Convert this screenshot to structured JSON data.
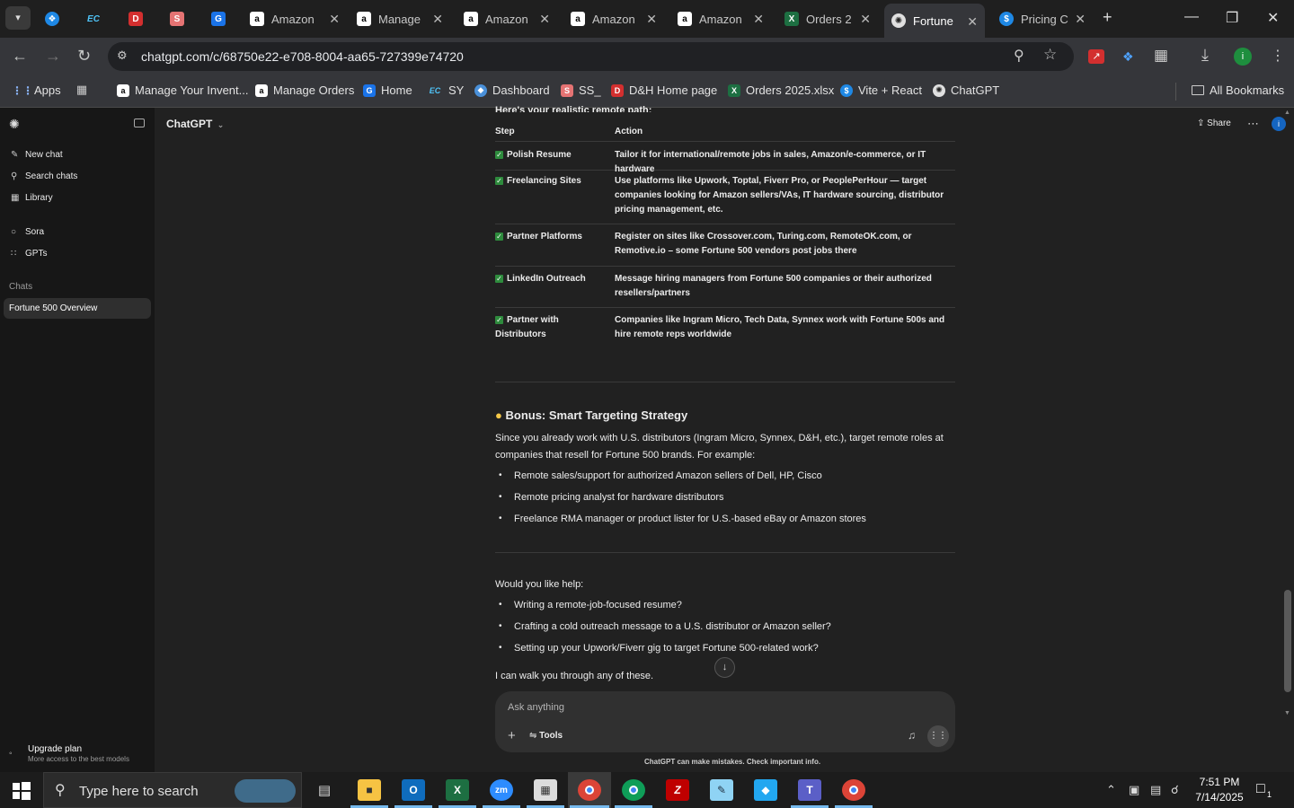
{
  "browser": {
    "tabs": [
      {
        "title": "",
        "icon": "dh-icon"
      },
      {
        "title": "",
        "icon": "ec-icon"
      },
      {
        "title": "",
        "icon": "dh-red-icon"
      },
      {
        "title": "",
        "icon": "ss-icon"
      },
      {
        "title": "",
        "icon": "google-drive-icon"
      },
      {
        "title": "Amazon",
        "icon": "amazon-icon"
      },
      {
        "title": "Manage",
        "icon": "amazon-icon"
      },
      {
        "title": "Amazon",
        "icon": "amazon-icon"
      },
      {
        "title": "Amazon",
        "icon": "amazon-icon"
      },
      {
        "title": "Amazon",
        "icon": "amazon-icon"
      },
      {
        "title": "Orders 2",
        "icon": "excel-icon"
      },
      {
        "title": "Fortune",
        "icon": "chatgpt-icon"
      },
      {
        "title": "Pricing C",
        "icon": "vite-icon"
      }
    ],
    "url": "chatgpt.com/c/68750e22-e708-8004-aa65-727399e74720",
    "bookmarks": [
      {
        "label": "Apps"
      },
      {
        "label": ""
      },
      {
        "label": "Manage Your Invent..."
      },
      {
        "label": "Manage Orders"
      },
      {
        "label": "Home"
      },
      {
        "label": "SY"
      },
      {
        "label": "Dashboard"
      },
      {
        "label": "SS_"
      },
      {
        "label": "D&H Home page"
      },
      {
        "label": "Orders 2025.xlsx"
      },
      {
        "label": "Vite + React"
      },
      {
        "label": "ChatGPT"
      }
    ],
    "all_bookmarks": "All Bookmarks"
  },
  "sidebar": {
    "items": [
      {
        "label": "New chat",
        "icon": "pencil-icon"
      },
      {
        "label": "Search chats",
        "icon": "search-icon"
      },
      {
        "label": "Library",
        "icon": "library-icon"
      },
      {
        "label": "Sora",
        "icon": "sora-icon"
      },
      {
        "label": "GPTs",
        "icon": "gpts-icon"
      }
    ],
    "section_label": "Chats",
    "active_chat": "Fortune 500 Overview",
    "upgrade_title": "Upgrade plan",
    "upgrade_sub": "More access to the best models"
  },
  "header": {
    "model": "ChatGPT",
    "share": "Share"
  },
  "content": {
    "cut_line": "Here's your realistic remote path:",
    "table_headers": [
      "Step",
      "Action"
    ],
    "rows": [
      {
        "step": "Polish Resume",
        "action": "Tailor it for international/remote jobs in sales, Amazon/e-commerce, or IT hardware"
      },
      {
        "step": "Freelancing Sites",
        "action": "Use platforms like Upwork, Toptal, Fiverr Pro, or PeoplePerHour — target companies looking for Amazon sellers/VAs, IT hardware sourcing, distributor pricing management, etc."
      },
      {
        "step": "Partner Platforms",
        "action": "Register on sites like Crossover.com, Turing.com, RemoteOK.com, or Remotive.io – some Fortune 500 vendors post jobs there"
      },
      {
        "step": "LinkedIn Outreach",
        "action": "Message hiring managers from Fortune 500 companies or their authorized resellers/partners"
      },
      {
        "step": "Partner with Distributors",
        "action": "Companies like Ingram Micro, Tech Data, Synnex work with Fortune 500s and hire remote reps worldwide"
      }
    ],
    "bonus_title": "Bonus: Smart Targeting Strategy",
    "bonus_para": "Since you already work with U.S. distributors (Ingram Micro, Synnex, D&H, etc.), target remote roles at companies that resell for Fortune 500 brands. For example:",
    "bonus_bullets": [
      "Remote sales/support for authorized Amazon sellers of Dell, HP, Cisco",
      "Remote pricing analyst for hardware distributors",
      "Freelance RMA manager or product lister for U.S.-based eBay or Amazon stores"
    ],
    "help_intro": "Would you like help:",
    "help_bullets": [
      "Writing a remote-job-focused resume?",
      "Crafting a cold outreach message to a U.S. distributor or Amazon seller?",
      "Setting up your Upwork/Fiverr gig to target Fortune 500-related work?"
    ],
    "closing": "I can walk you through any of these."
  },
  "composer": {
    "placeholder": "Ask anything",
    "tools": "Tools",
    "disclaimer": "ChatGPT can make mistakes. Check important info."
  },
  "taskbar": {
    "search_placeholder": "Type here to search",
    "time": "7:51 PM",
    "date": "7/14/2025",
    "notif_count": "1"
  }
}
